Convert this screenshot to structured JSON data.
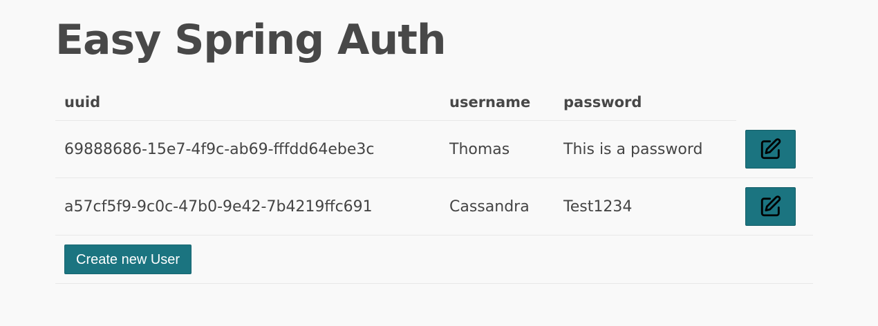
{
  "page": {
    "title": "Easy Spring Auth"
  },
  "table": {
    "headers": {
      "uuid": "uuid",
      "username": "username",
      "password": "password"
    },
    "rows": [
      {
        "uuid": "69888686-15e7-4f9c-ab69-fffdd64ebe3c",
        "username": "Thomas",
        "password": "This is a password",
        "action_icon": "edit-icon"
      },
      {
        "uuid": "a57cf5f9-9c0c-47b0-9e42-7b4219ffc691",
        "username": "Cassandra",
        "password": "Test1234",
        "action_icon": "edit-icon"
      }
    ]
  },
  "actions": {
    "create_label": "Create new User"
  },
  "colors": {
    "background": "#f9f9f9",
    "accent": "#1b7480",
    "text": "#454545"
  }
}
